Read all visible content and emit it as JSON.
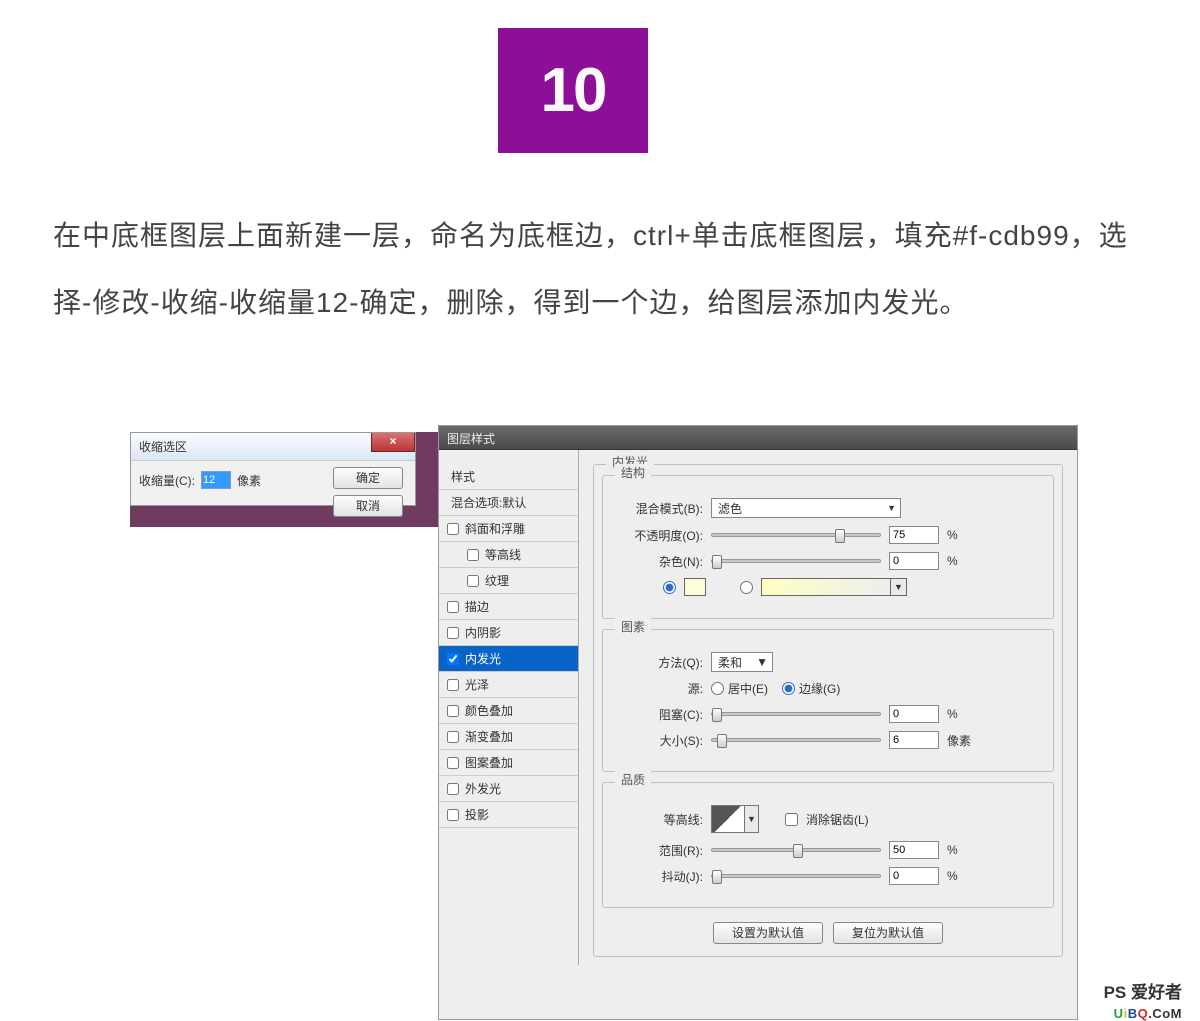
{
  "step_number": "10",
  "instruction_text": "在中底框图层上面新建一层，命名为底框边，ctrl+单击底框图层，填充#f-cdb99，选择-修改-收缩-收缩量12-确定，删除，得到一个边，给图层添加内发光。",
  "shrink_dialog": {
    "title": "收缩选区",
    "close": "×",
    "amount_label": "收缩量(C):",
    "amount_value": "12",
    "unit": "像素",
    "ok": "确定",
    "cancel": "取消"
  },
  "layer_style": {
    "title": "图层样式",
    "sidebar": {
      "style_header": "样式",
      "blending_header": "混合选项:默认",
      "items": [
        {
          "label": "斜面和浮雕",
          "checked": false
        },
        {
          "label": "等高线",
          "checked": false,
          "sub": true
        },
        {
          "label": "纹理",
          "checked": false,
          "sub": true
        },
        {
          "label": "描边",
          "checked": false
        },
        {
          "label": "内阴影",
          "checked": false
        },
        {
          "label": "内发光",
          "checked": true,
          "active": true
        },
        {
          "label": "光泽",
          "checked": false
        },
        {
          "label": "颜色叠加",
          "checked": false
        },
        {
          "label": "渐变叠加",
          "checked": false
        },
        {
          "label": "图案叠加",
          "checked": false
        },
        {
          "label": "外发光",
          "checked": false
        },
        {
          "label": "投影",
          "checked": false
        }
      ]
    },
    "panel_title": "内发光",
    "structure": {
      "group_label": "结构",
      "blend_mode_label": "混合模式(B):",
      "blend_mode_value": "滤色",
      "opacity_label": "不透明度(O):",
      "opacity_value": "75",
      "percent": "%",
      "noise_label": "杂色(N):",
      "noise_value": "0",
      "color_swatch": "#fffdd9"
    },
    "elements": {
      "group_label": "图素",
      "technique_label": "方法(Q):",
      "technique_value": "柔和",
      "source_label": "源:",
      "source_center": "居中(E)",
      "source_edge": "边缘(G)",
      "choke_label": "阻塞(C):",
      "choke_value": "0",
      "size_label": "大小(S):",
      "size_value": "6",
      "pixels": "像素"
    },
    "quality": {
      "group_label": "品质",
      "contour_label": "等高线:",
      "antialias_label": "消除锯齿(L)",
      "range_label": "范围(R):",
      "range_value": "50",
      "jitter_label": "抖动(J):",
      "jitter_value": "0",
      "percent": "%"
    },
    "buttons": {
      "default": "设置为默认值",
      "reset": "复位为默认值"
    }
  },
  "watermark": {
    "top": "PS 爱好者",
    "u": "U",
    "i": "i",
    "b": "B",
    "q": "Q",
    "dot": ".",
    "com": "CoM"
  }
}
